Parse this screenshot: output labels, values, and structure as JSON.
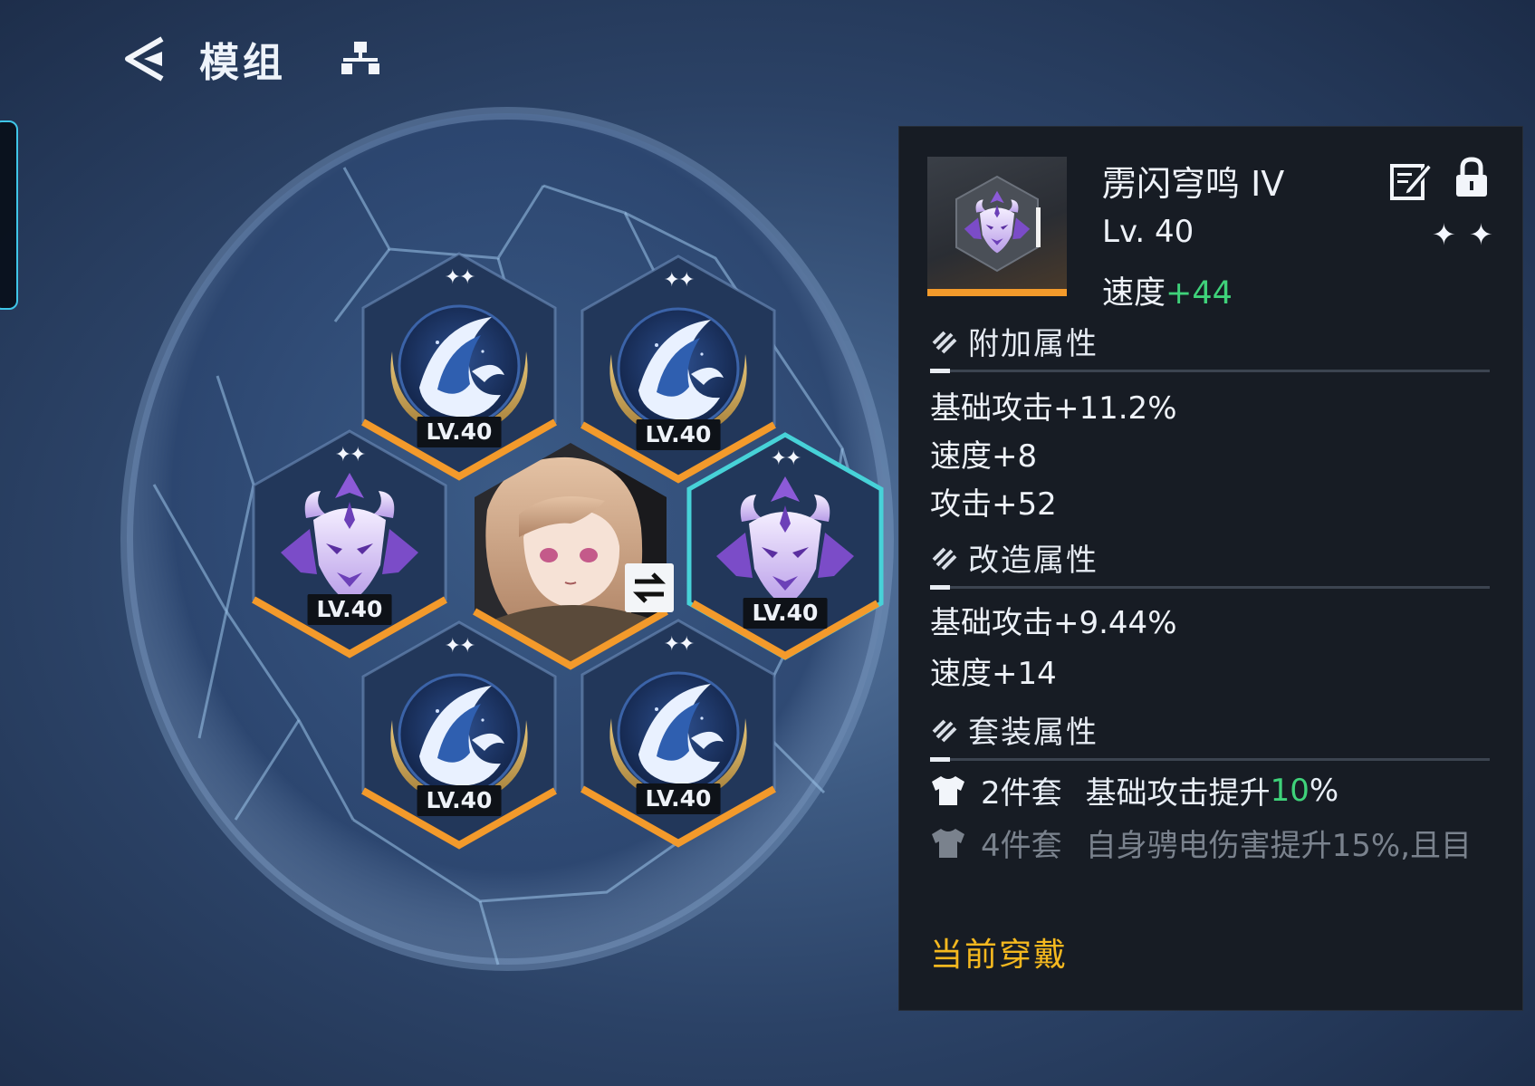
{
  "header": {
    "title": "模组"
  },
  "modules": [
    {
      "level": "LV.40",
      "stars": "✦✦",
      "emblem": "wave"
    },
    {
      "level": "LV.40",
      "stars": "✦✦",
      "emblem": "wave"
    },
    {
      "level": "LV.40",
      "stars": "✦✦",
      "emblem": "beast"
    },
    {
      "level": "LV.40",
      "stars": "✦✦",
      "emblem": "beast",
      "selected": true
    },
    {
      "level": "LV.40",
      "stars": "✦✦",
      "emblem": "wave"
    },
    {
      "level": "LV.40",
      "stars": "✦✦",
      "emblem": "wave"
    }
  ],
  "detail": {
    "name": "雳闪穹鸣 IV",
    "level": "Lv. 40",
    "main_stat_label": "速度",
    "main_stat_value": "+44",
    "rarity_stars": "✦ ✦",
    "extra_title": "附加属性",
    "extra_stats": [
      "基础攻击+11.2%",
      "速度+8",
      "攻击+52"
    ],
    "reforge_title": "改造属性",
    "reforge_stats": [
      "基础攻击+9.44%",
      "速度+14"
    ],
    "set_title": "套装属性",
    "set2": {
      "pieces": "2件套",
      "text": "基础攻击提升",
      "value": "10",
      "suffix": "%"
    },
    "set4": {
      "pieces": "4件套",
      "text": "自身骋电伤害提升15%,且目"
    },
    "status": "当前穿戴"
  },
  "colors": {
    "accent_orange": "#f39a2b",
    "selected_cyan": "#47d2d8",
    "bonus_green": "#3fd27a",
    "status_yellow": "#f4b81f"
  },
  "icons": [
    "back-icon",
    "tree-icon",
    "swap-icon",
    "edit-icon",
    "lock-icon",
    "shirt-icon",
    "slash-icon"
  ]
}
